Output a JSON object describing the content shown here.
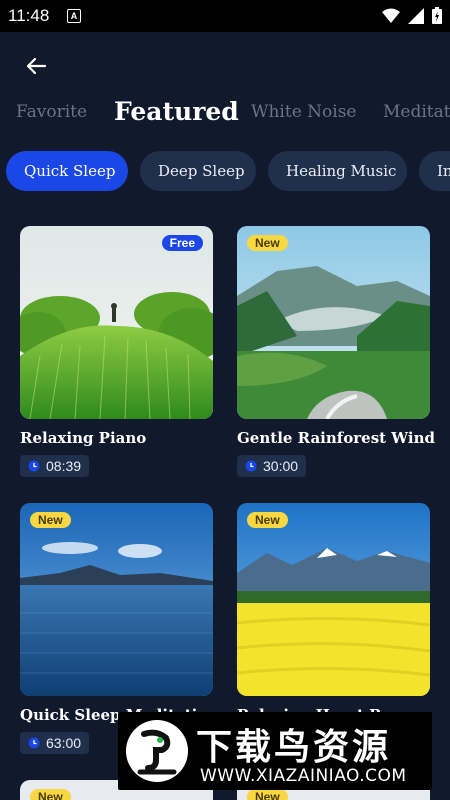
{
  "status_bar": {
    "time": "11:48",
    "notification_icon": "A",
    "icons": [
      "wifi-icon",
      "signal-icon",
      "battery-icon"
    ]
  },
  "nav": {
    "back_icon": "arrow-left-icon"
  },
  "tabs": [
    {
      "label": "Favorite",
      "active": false
    },
    {
      "label": "Featured",
      "active": true
    },
    {
      "label": "White Noise",
      "active": false
    },
    {
      "label": "Meditati",
      "active": false
    }
  ],
  "chips": [
    {
      "label": "Quick Sleep",
      "active": true
    },
    {
      "label": "Deep Sleep",
      "active": false
    },
    {
      "label": "Healing Music",
      "active": false
    },
    {
      "label": "In",
      "active": false
    }
  ],
  "cards": [
    {
      "title": "Relaxing Piano",
      "duration": "08:39",
      "badge": "Free"
    },
    {
      "title": "Gentle Rainforest Wind",
      "duration": "30:00",
      "badge": "New"
    },
    {
      "title": "Quick Sleep Meditati",
      "duration": "63:00",
      "badge": "New"
    },
    {
      "title": "Relaxing Heart R",
      "duration": "",
      "badge": "New"
    },
    {
      "title": "",
      "duration": "",
      "badge": "New"
    },
    {
      "title": "",
      "duration": "",
      "badge": "New"
    }
  ],
  "watermark": {
    "title": "下载鸟资源",
    "url": "WWW.XIAZAINIAO.COM"
  },
  "colors": {
    "background": "#111a2c",
    "accent": "#1a47e5",
    "chip": "#1f2f4c",
    "badge_new": "#f7d742"
  }
}
